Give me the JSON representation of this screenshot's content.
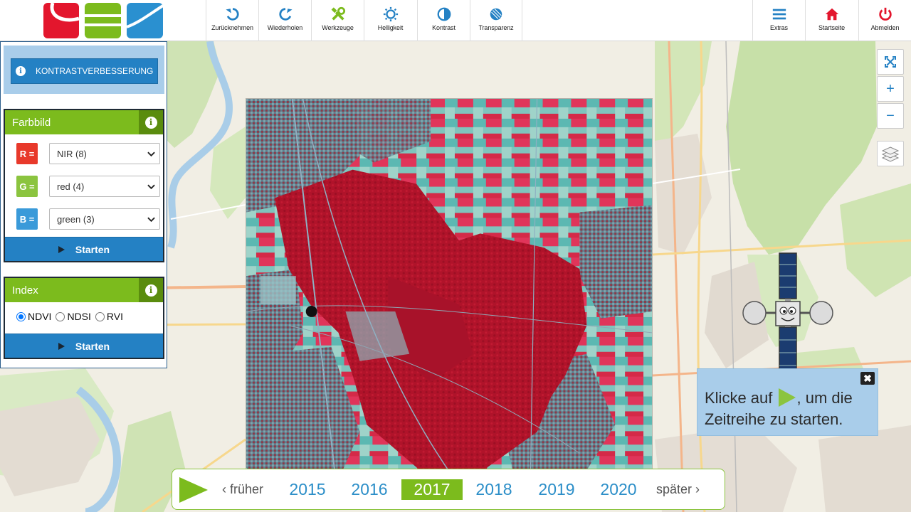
{
  "toolbar": {
    "tools": [
      {
        "key": "undo",
        "label": "Zurücknehmen",
        "icon": "undo-icon"
      },
      {
        "key": "redo",
        "label": "Wiederholen",
        "icon": "redo-icon"
      },
      {
        "key": "tools",
        "label": "Werkzeuge",
        "icon": "tools-icon"
      },
      {
        "key": "brightness",
        "label": "Helligkeit",
        "icon": "brightness-icon"
      },
      {
        "key": "contrast",
        "label": "Kontrast",
        "icon": "contrast-icon"
      },
      {
        "key": "transparency",
        "label": "Transparenz",
        "icon": "transparency-icon"
      }
    ],
    "right_tools": [
      {
        "key": "extras",
        "label": "Extras",
        "icon": "menu-icon"
      },
      {
        "key": "home",
        "label": "Startseite",
        "icon": "home-icon"
      },
      {
        "key": "logout",
        "label": "Abmelden",
        "icon": "power-icon"
      }
    ]
  },
  "sidebar": {
    "contrast_button": "KONTRASTVERBESSERUNG",
    "farbbild": {
      "title": "Farbbild",
      "bands": [
        {
          "tag": "R =",
          "value": "NIR (8)",
          "color": "#e8392b"
        },
        {
          "tag": "G =",
          "value": "red (4)",
          "color": "#8bc43f"
        },
        {
          "tag": "B =",
          "value": "green (3)",
          "color": "#3a9ad9"
        }
      ],
      "start": "Starten"
    },
    "index": {
      "title": "Index",
      "options": [
        "NDVI",
        "NDSI",
        "RVI"
      ],
      "selected": "NDVI",
      "start": "Starten"
    }
  },
  "map_controls": {
    "fullscreen": "fullscreen-icon",
    "zoom_in": "+",
    "zoom_out": "−",
    "layers": "layers-icon"
  },
  "hint": {
    "text_before": "Klicke auf",
    "text_after": ", um die Zeitreihe zu starten."
  },
  "timeline": {
    "earlier": "früher",
    "later": "später",
    "years": [
      "2015",
      "2016",
      "2017",
      "2018",
      "2019",
      "2020"
    ],
    "active": "2017"
  },
  "colors": {
    "accent_blue": "#2481c4",
    "accent_green": "#7cbb1d",
    "light_blue": "#a9cdea"
  }
}
